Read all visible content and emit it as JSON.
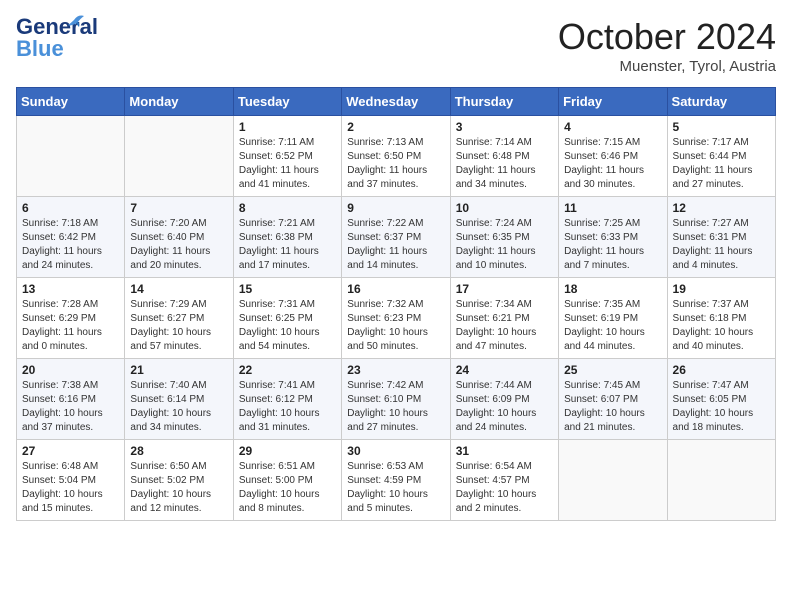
{
  "header": {
    "logo_line1": "General",
    "logo_line2": "Blue",
    "month": "October 2024",
    "location": "Muenster, Tyrol, Austria"
  },
  "columns": [
    "Sunday",
    "Monday",
    "Tuesday",
    "Wednesday",
    "Thursday",
    "Friday",
    "Saturday"
  ],
  "weeks": [
    [
      {
        "day": "",
        "text": ""
      },
      {
        "day": "",
        "text": ""
      },
      {
        "day": "1",
        "text": "Sunrise: 7:11 AM\nSunset: 6:52 PM\nDaylight: 11 hours and 41 minutes."
      },
      {
        "day": "2",
        "text": "Sunrise: 7:13 AM\nSunset: 6:50 PM\nDaylight: 11 hours and 37 minutes."
      },
      {
        "day": "3",
        "text": "Sunrise: 7:14 AM\nSunset: 6:48 PM\nDaylight: 11 hours and 34 minutes."
      },
      {
        "day": "4",
        "text": "Sunrise: 7:15 AM\nSunset: 6:46 PM\nDaylight: 11 hours and 30 minutes."
      },
      {
        "day": "5",
        "text": "Sunrise: 7:17 AM\nSunset: 6:44 PM\nDaylight: 11 hours and 27 minutes."
      }
    ],
    [
      {
        "day": "6",
        "text": "Sunrise: 7:18 AM\nSunset: 6:42 PM\nDaylight: 11 hours and 24 minutes."
      },
      {
        "day": "7",
        "text": "Sunrise: 7:20 AM\nSunset: 6:40 PM\nDaylight: 11 hours and 20 minutes."
      },
      {
        "day": "8",
        "text": "Sunrise: 7:21 AM\nSunset: 6:38 PM\nDaylight: 11 hours and 17 minutes."
      },
      {
        "day": "9",
        "text": "Sunrise: 7:22 AM\nSunset: 6:37 PM\nDaylight: 11 hours and 14 minutes."
      },
      {
        "day": "10",
        "text": "Sunrise: 7:24 AM\nSunset: 6:35 PM\nDaylight: 11 hours and 10 minutes."
      },
      {
        "day": "11",
        "text": "Sunrise: 7:25 AM\nSunset: 6:33 PM\nDaylight: 11 hours and 7 minutes."
      },
      {
        "day": "12",
        "text": "Sunrise: 7:27 AM\nSunset: 6:31 PM\nDaylight: 11 hours and 4 minutes."
      }
    ],
    [
      {
        "day": "13",
        "text": "Sunrise: 7:28 AM\nSunset: 6:29 PM\nDaylight: 11 hours and 0 minutes."
      },
      {
        "day": "14",
        "text": "Sunrise: 7:29 AM\nSunset: 6:27 PM\nDaylight: 10 hours and 57 minutes."
      },
      {
        "day": "15",
        "text": "Sunrise: 7:31 AM\nSunset: 6:25 PM\nDaylight: 10 hours and 54 minutes."
      },
      {
        "day": "16",
        "text": "Sunrise: 7:32 AM\nSunset: 6:23 PM\nDaylight: 10 hours and 50 minutes."
      },
      {
        "day": "17",
        "text": "Sunrise: 7:34 AM\nSunset: 6:21 PM\nDaylight: 10 hours and 47 minutes."
      },
      {
        "day": "18",
        "text": "Sunrise: 7:35 AM\nSunset: 6:19 PM\nDaylight: 10 hours and 44 minutes."
      },
      {
        "day": "19",
        "text": "Sunrise: 7:37 AM\nSunset: 6:18 PM\nDaylight: 10 hours and 40 minutes."
      }
    ],
    [
      {
        "day": "20",
        "text": "Sunrise: 7:38 AM\nSunset: 6:16 PM\nDaylight: 10 hours and 37 minutes."
      },
      {
        "day": "21",
        "text": "Sunrise: 7:40 AM\nSunset: 6:14 PM\nDaylight: 10 hours and 34 minutes."
      },
      {
        "day": "22",
        "text": "Sunrise: 7:41 AM\nSunset: 6:12 PM\nDaylight: 10 hours and 31 minutes."
      },
      {
        "day": "23",
        "text": "Sunrise: 7:42 AM\nSunset: 6:10 PM\nDaylight: 10 hours and 27 minutes."
      },
      {
        "day": "24",
        "text": "Sunrise: 7:44 AM\nSunset: 6:09 PM\nDaylight: 10 hours and 24 minutes."
      },
      {
        "day": "25",
        "text": "Sunrise: 7:45 AM\nSunset: 6:07 PM\nDaylight: 10 hours and 21 minutes."
      },
      {
        "day": "26",
        "text": "Sunrise: 7:47 AM\nSunset: 6:05 PM\nDaylight: 10 hours and 18 minutes."
      }
    ],
    [
      {
        "day": "27",
        "text": "Sunrise: 6:48 AM\nSunset: 5:04 PM\nDaylight: 10 hours and 15 minutes."
      },
      {
        "day": "28",
        "text": "Sunrise: 6:50 AM\nSunset: 5:02 PM\nDaylight: 10 hours and 12 minutes."
      },
      {
        "day": "29",
        "text": "Sunrise: 6:51 AM\nSunset: 5:00 PM\nDaylight: 10 hours and 8 minutes."
      },
      {
        "day": "30",
        "text": "Sunrise: 6:53 AM\nSunset: 4:59 PM\nDaylight: 10 hours and 5 minutes."
      },
      {
        "day": "31",
        "text": "Sunrise: 6:54 AM\nSunset: 4:57 PM\nDaylight: 10 hours and 2 minutes."
      },
      {
        "day": "",
        "text": ""
      },
      {
        "day": "",
        "text": ""
      }
    ]
  ]
}
